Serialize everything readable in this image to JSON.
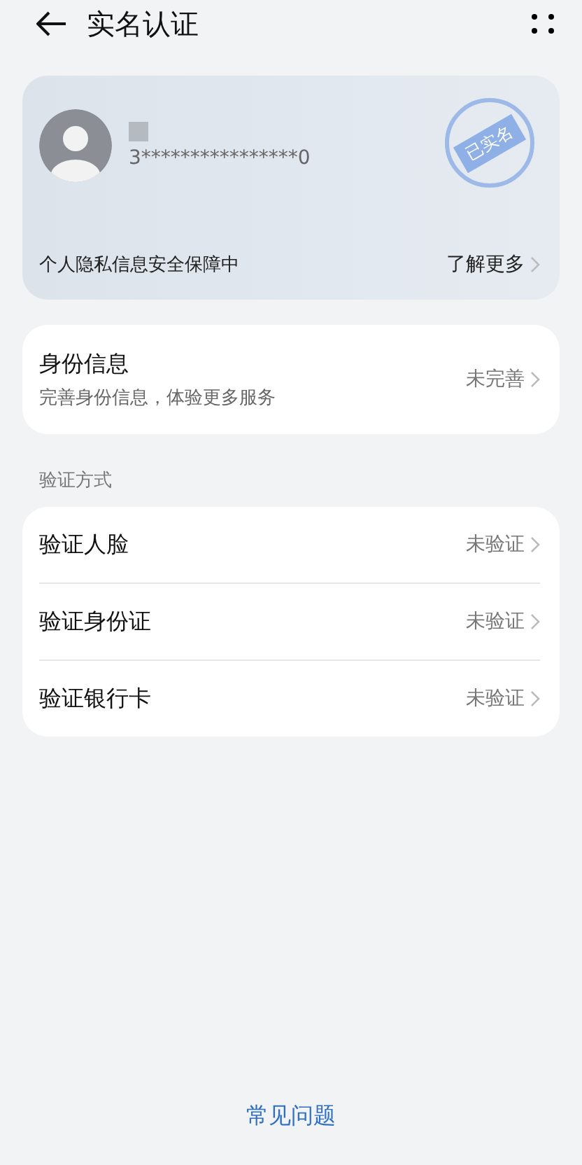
{
  "header": {
    "title": "实名认证"
  },
  "profile_card": {
    "id_number": "3****************0",
    "stamp": "已实名",
    "privacy_note": "个人隐私信息安全保障中",
    "learn_more": "了解更多"
  },
  "identity_info": {
    "title": "身份信息",
    "subtitle": "完善身份信息，体验更多服务",
    "status": "未完善"
  },
  "section_label": "验证方式",
  "methods": [
    {
      "label": "验证人脸",
      "status": "未验证"
    },
    {
      "label": "验证身份证",
      "status": "未验证"
    },
    {
      "label": "验证银行卡",
      "status": "未验证"
    }
  ],
  "footer_link": "常见问题"
}
